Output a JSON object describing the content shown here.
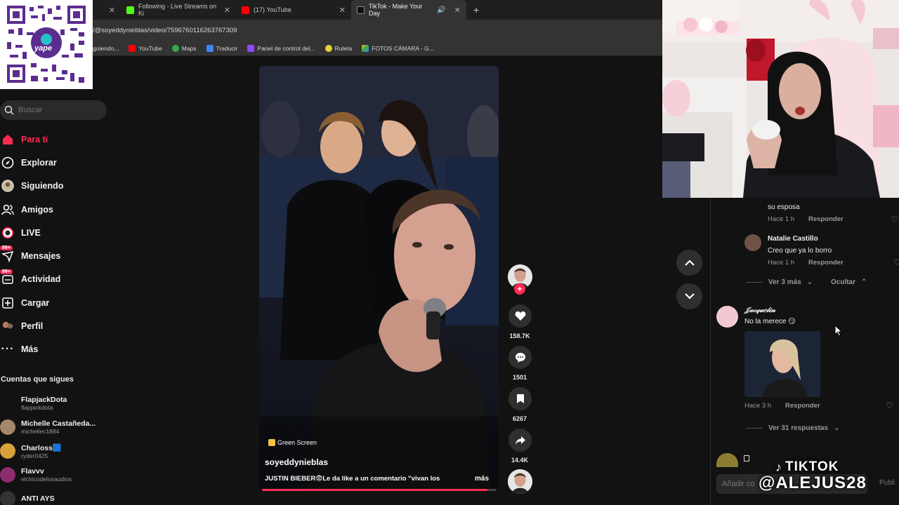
{
  "browser": {
    "tabs": [
      {
        "label": "",
        "active": false
      },
      {
        "label": "Following - Live Streams on Ki",
        "active": false
      },
      {
        "label": "(17) YouTube",
        "active": false
      },
      {
        "label": "TikTok - Make Your Day",
        "active": true
      }
    ],
    "url": "/@soyeddynieblas/video/7596760116263767309",
    "bookmarks": [
      "guiendo...",
      "YouTube",
      "Maps",
      "Traducir",
      "Panel de control del...",
      "Ruleta",
      "FOTOS CÁMARA - G..."
    ]
  },
  "qr": {
    "label": "yape"
  },
  "sidebar": {
    "search_placeholder": "Buscar",
    "nav": [
      {
        "label": "Para ti",
        "icon": "home-icon",
        "active": true
      },
      {
        "label": "Explorar",
        "icon": "compass-icon"
      },
      {
        "label": "Siguiendo",
        "icon": "following-avatar-icon"
      },
      {
        "label": "Amigos",
        "icon": "friends-icon"
      },
      {
        "label": "LIVE",
        "icon": "live-icon"
      },
      {
        "label": "Mensajes",
        "icon": "messages-icon",
        "badge": "99+"
      },
      {
        "label": "Actividad",
        "icon": "activity-icon",
        "badge": "99+"
      },
      {
        "label": "Cargar",
        "icon": "upload-icon"
      },
      {
        "label": "Perfil",
        "icon": "profile-icon"
      },
      {
        "label": "Más",
        "icon": "more-icon"
      }
    ],
    "following_title": "Cuentas que sigues",
    "accounts": [
      {
        "name": "FlapjackDota",
        "user": "flapjackdota"
      },
      {
        "name": "Michelle Castañeda...",
        "user": "michellec1884"
      },
      {
        "name": "Charloss🟦",
        "user": "ryder0425"
      },
      {
        "name": "Flavvv",
        "user": "elchicodelosaudios"
      },
      {
        "name": "ANTI AYS",
        "user": ""
      }
    ]
  },
  "video": {
    "tag": "Green Screen",
    "username": "soyeddynieblas",
    "description": "JUSTIN BIEBER😨Le da like a un comentario \"vivan los",
    "more": "más",
    "progress": 0.96
  },
  "actions": {
    "likes": "158.7K",
    "comments": "1501",
    "saves": "6267",
    "shares": "14.4K"
  },
  "comments": {
    "top_text": "su esposa",
    "c1_meta": {
      "time": "Hace 1 h",
      "reply": "Responder"
    },
    "c2": {
      "name": "Natalie Castillo",
      "text": "Creo que ya lo borro",
      "time": "Hace 1 h",
      "reply": "Responder"
    },
    "view_more": "Ver 3 más",
    "hide": "Ocultar",
    "c3": {
      "name": "𝒥𝒶𝒸𝓆𝓊𝑒𝓁𝒾𝓃",
      "text": "No la merece 😏",
      "time": "Hace 3 h",
      "reply": "Responder"
    },
    "view_replies": "Ver 31 respuestas",
    "add_placeholder": "Añadir co",
    "publish": "Publi"
  },
  "watermark": {
    "line1": "TIKTOK",
    "line2": "@ALEJUS28"
  },
  "colors": {
    "accent": "#fe2c55",
    "bg": "#121212"
  }
}
